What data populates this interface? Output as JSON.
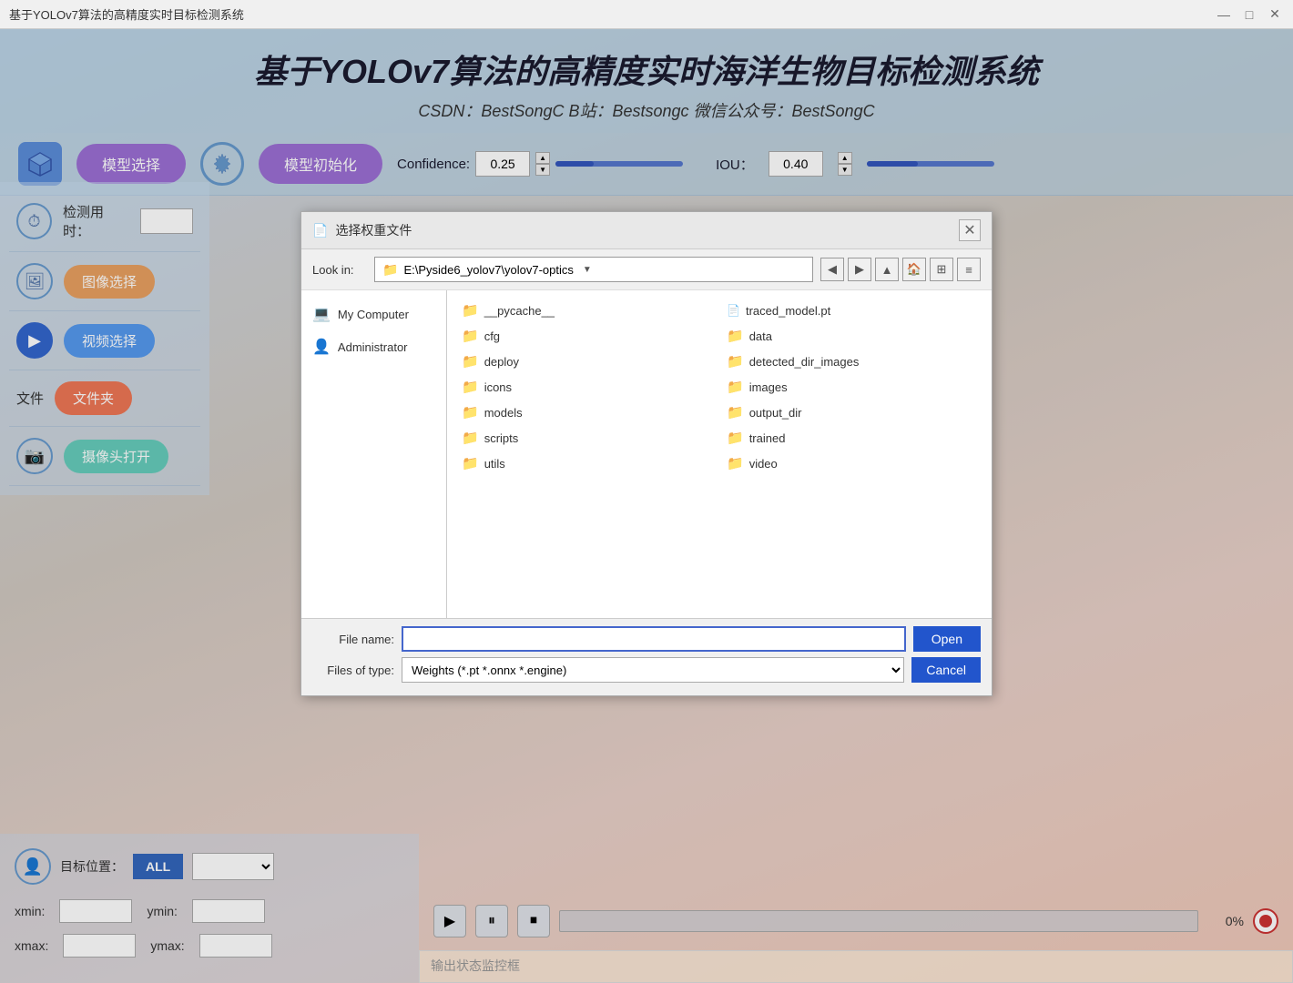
{
  "titleBar": {
    "title": "基于YOLOv7算法的高精度实时目标检测系统",
    "minimizeLabel": "—",
    "maximizeLabel": "□",
    "closeLabel": "✕"
  },
  "header": {
    "mainTitle": "基于YOLOv7算法的高精度实时海洋生物目标检测系统",
    "subTitle": "CSDN：BestSongC   B站：Bestsongc   微信公众号：BestSongC"
  },
  "toolbar": {
    "modelSelectLabel": "模型选择",
    "modelInitLabel": "模型初始化",
    "confidenceLabel": "Confidence:",
    "confidenceValue": "0.25",
    "iouLabel": "IOU：",
    "iouValue": "0.40"
  },
  "sidebar": {
    "detectionTimeLabel": "检测用时：",
    "imageSelectLabel": "图像选择",
    "videoSelectLabel": "视频选择",
    "folderLabel": "文件夹",
    "cameraLabel": "摄像头打开",
    "sidebarLabel1": "文件"
  },
  "bottomLeft": {
    "targetPositionLabel": "目标位置：",
    "allLabel": "ALL",
    "xminLabel": "xmin:",
    "yminLabel": "ymin:",
    "xmaxLabel": "xmax:",
    "ymaxLabel": "ymax:"
  },
  "mediaControls": {
    "playLabel": "▶",
    "pauseLabel": "⏸",
    "stopLabel": "⏹",
    "progressPercent": "0%"
  },
  "statusMonitor": {
    "placeholder": "输出状态监控框"
  },
  "fileDialog": {
    "title": "选择权重文件",
    "closeLabel": "✕",
    "lookinLabel": "Look in:",
    "currentPath": "E:\\Pyside6_yolov7\\yolov7-optics",
    "treeItems": [
      {
        "icon": "💻",
        "label": "My Computer"
      },
      {
        "icon": "👤",
        "label": "Administrator"
      }
    ],
    "files": [
      {
        "type": "folder",
        "name": "__pycache__"
      },
      {
        "type": "file",
        "name": "traced_model.pt"
      },
      {
        "type": "folder",
        "name": "cfg"
      },
      {
        "type": "folder",
        "name": "data"
      },
      {
        "type": "folder",
        "name": "deploy"
      },
      {
        "type": "folder",
        "name": "detected_dir_images"
      },
      {
        "type": "folder",
        "name": "icons"
      },
      {
        "type": "folder",
        "name": "images"
      },
      {
        "type": "folder",
        "name": "models"
      },
      {
        "type": "folder",
        "name": "output_dir"
      },
      {
        "type": "folder",
        "name": "scripts"
      },
      {
        "type": "folder",
        "name": "trained"
      },
      {
        "type": "folder",
        "name": "utils"
      },
      {
        "type": "folder",
        "name": "video"
      }
    ],
    "fileNameLabel": "File name:",
    "fileNameValue": "",
    "filesOfTypeLabel": "Files of type:",
    "filesOfTypeValue": "Weights (*.pt *.onnx *.engine)",
    "openLabel": "Open",
    "cancelLabel": "Cancel"
  }
}
